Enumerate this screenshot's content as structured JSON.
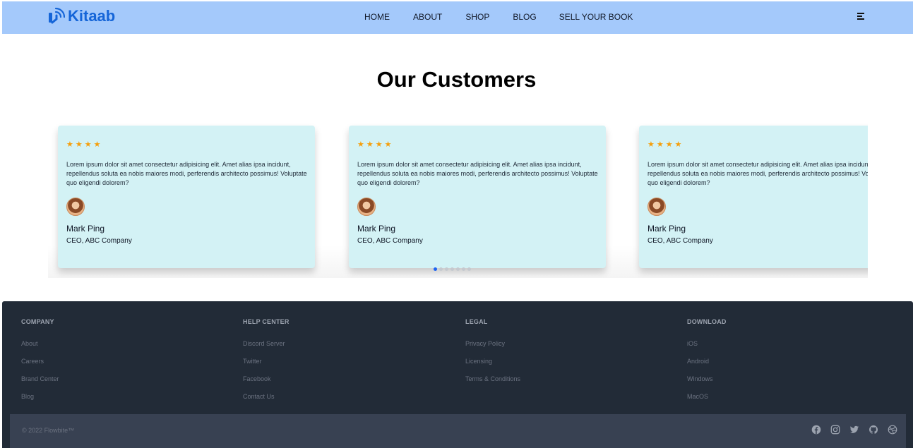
{
  "brand": {
    "name": "Kitaab",
    "icon": "wifi-book-icon",
    "color": "#1565d8"
  },
  "nav": {
    "links": [
      "HOME",
      "ABOUT",
      "SHOP",
      "BLOG",
      "SELL YOUR BOOK"
    ],
    "menu_icon": "hamburger-menu-icon",
    "background": "#a4c9fb"
  },
  "section": {
    "title": "Our Customers"
  },
  "testimonials": [
    {
      "stars": "★★★★",
      "quote": "Lorem ipsum dolor sit amet consectetur adipisicing elit. Amet alias ipsa incidunt, repellendus soluta ea nobis maiores modi, perferendis architecto possimus! Voluptate quo eligendi dolorem?",
      "name": "Mark Ping",
      "role": "CEO, ABC Company"
    },
    {
      "stars": "★★★★",
      "quote": "Lorem ipsum dolor sit amet consectetur adipisicing elit. Amet alias ipsa incidunt, repellendus soluta ea nobis maiores modi, perferendis architecto possimus! Voluptate quo eligendi dolorem?",
      "name": "Mark Ping",
      "role": "CEO, ABC Company"
    },
    {
      "stars": "★★★★",
      "quote": "Lorem ipsum dolor sit amet consectetur adipisicing elit. Amet alias ipsa incidunt, repellendus soluta ea nobis maiores modi, perferendis architecto possimus! Voluptate quo eligendi dolorem?",
      "name": "Mark Ping",
      "role": "CEO, ABC Company"
    }
  ],
  "carousel": {
    "slide_count": 7,
    "active_slide": 1,
    "active_color": "#1c64f2"
  },
  "footer": {
    "columns": [
      {
        "title": "COMPANY",
        "links": [
          "About",
          "Careers",
          "Brand Center",
          "Blog"
        ]
      },
      {
        "title": "HELP CENTER",
        "links": [
          "Discord Server",
          "Twitter",
          "Facebook",
          "Contact Us"
        ]
      },
      {
        "title": "LEGAL",
        "links": [
          "Privacy Policy",
          "Licensing",
          "Terms & Conditions"
        ]
      },
      {
        "title": "DOWNLOAD",
        "links": [
          "iOS",
          "Android",
          "Windows",
          "MacOS"
        ]
      }
    ],
    "copyright": "© 2022 Flowbite™",
    "social_icons": [
      "facebook-icon",
      "instagram-icon",
      "twitter-icon",
      "github-icon",
      "dribbble-icon"
    ],
    "background": "#222b37"
  }
}
